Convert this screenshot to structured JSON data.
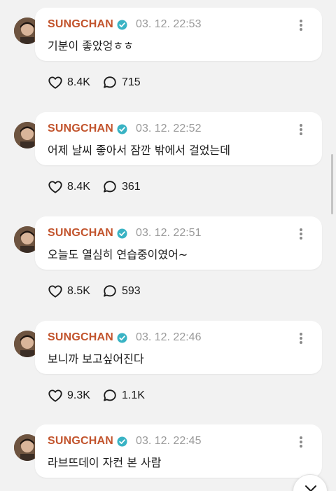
{
  "posts": [
    {
      "author": "SUNGCHAN",
      "timestamp": "03. 12. 22:53",
      "text": "기분이 좋았엉ㅎㅎ",
      "likes": "8.4K",
      "comments": "715"
    },
    {
      "author": "SUNGCHAN",
      "timestamp": "03. 12. 22:52",
      "text": "어제 날씨 좋아서 잠깐 밖에서 걸었는데",
      "likes": "8.4K",
      "comments": "361"
    },
    {
      "author": "SUNGCHAN",
      "timestamp": "03. 12. 22:51",
      "text": "오늘도 열심히 연습중이였어~",
      "likes": "8.5K",
      "comments": "593"
    },
    {
      "author": "SUNGCHAN",
      "timestamp": "03. 12. 22:46",
      "text": "보니까 보고싶어진다",
      "likes": "9.3K",
      "comments": "1.1K"
    },
    {
      "author": "SUNGCHAN",
      "timestamp": "03. 12. 22:45",
      "text": "라브뜨데이 자컨 본 사람",
      "likes": "",
      "comments": ""
    }
  ],
  "icons": {
    "verified": "verified-badge-icon",
    "more": "more-vertical-icon",
    "like": "heart-icon",
    "comment": "comment-bubble-icon",
    "scroll_down": "chevron-down-icon"
  },
  "colors": {
    "author_name": "#c2542d",
    "verified_badge": "#39b3c4",
    "timestamp": "#9a9a9a",
    "background": "#f2f2f2"
  }
}
